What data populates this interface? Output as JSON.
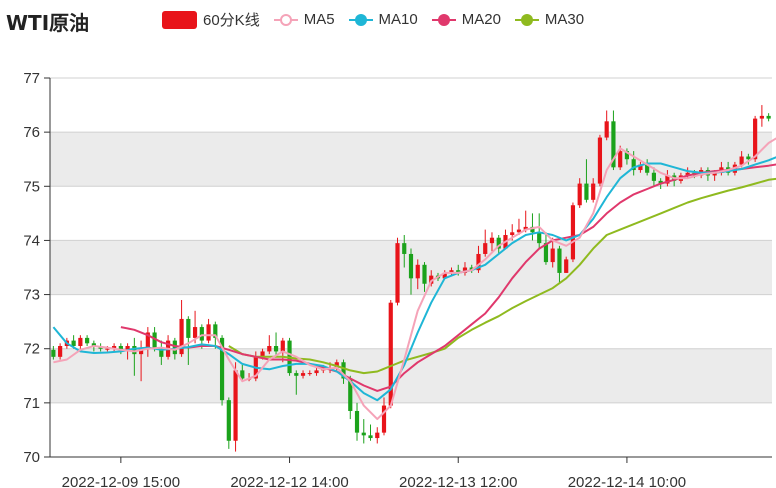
{
  "header": {
    "title": "WTI原油"
  },
  "legend": [
    {
      "label": "60分K线",
      "kind": "bar",
      "color": "#e8141a"
    },
    {
      "label": "MA5",
      "kind": "line",
      "color": "#f5a3b8"
    },
    {
      "label": "MA10",
      "kind": "line",
      "color": "#1fb6d6"
    },
    {
      "label": "MA20",
      "kind": "line",
      "color": "#e0386c"
    },
    {
      "label": "MA30",
      "kind": "line",
      "color": "#8fba1f"
    }
  ],
  "colors": {
    "up": "#e8141a",
    "down": "#1ba21b",
    "band": "#ebebeb",
    "grid": "#d0d0d0",
    "axis": "#333333"
  },
  "chart_data": {
    "type": "candlestick",
    "ylim": [
      70,
      77
    ],
    "yticks": [
      70,
      71,
      72,
      73,
      74,
      75,
      76,
      77
    ],
    "xtick_labels": [
      "2022-12-09 15:00",
      "2022-12-12 14:00",
      "2022-12-13 12:00",
      "2022-12-14 10:00"
    ],
    "xtick_index": [
      10,
      35,
      60,
      85
    ],
    "candles": [
      [
        71.98,
        71.85,
        72.05,
        71.8
      ],
      [
        71.85,
        72.05,
        72.1,
        71.8
      ],
      [
        72.05,
        72.15,
        72.2,
        72.0
      ],
      [
        72.15,
        72.05,
        72.25,
        72.0
      ],
      [
        72.05,
        72.2,
        72.25,
        72.0
      ],
      [
        72.2,
        72.1,
        72.25,
        72.05
      ],
      [
        72.1,
        72.05,
        72.15,
        71.95
      ],
      [
        72.05,
        72.0,
        72.1,
        71.95
      ],
      [
        72.0,
        72.0,
        72.05,
        71.95
      ],
      [
        72.0,
        72.05,
        72.1,
        71.95
      ],
      [
        72.05,
        71.95,
        72.1,
        71.9
      ],
      [
        71.95,
        72.05,
        72.1,
        71.8
      ],
      [
        72.05,
        71.9,
        72.2,
        71.5
      ],
      [
        71.9,
        72.0,
        72.15,
        71.4
      ],
      [
        72.0,
        72.3,
        72.4,
        71.85
      ],
      [
        72.3,
        72.0,
        72.4,
        71.95
      ],
      [
        72.0,
        71.85,
        72.15,
        71.7
      ],
      [
        71.85,
        72.15,
        72.25,
        71.8
      ],
      [
        72.15,
        71.9,
        72.2,
        71.8
      ],
      [
        71.9,
        72.55,
        72.9,
        71.85
      ],
      [
        72.55,
        72.2,
        72.6,
        71.7
      ],
      [
        72.2,
        72.4,
        72.7,
        72.1
      ],
      [
        72.4,
        72.15,
        72.45,
        72.0
      ],
      [
        72.15,
        72.45,
        72.55,
        72.1
      ],
      [
        72.45,
        72.2,
        72.5,
        72.0
      ],
      [
        72.2,
        71.05,
        72.25,
        70.95
      ],
      [
        71.05,
        70.3,
        71.1,
        70.15
      ],
      [
        70.3,
        71.6,
        71.75,
        70.1
      ],
      [
        71.6,
        71.45,
        71.7,
        71.4
      ],
      [
        71.45,
        71.45,
        71.55,
        71.4
      ],
      [
        71.45,
        71.85,
        71.95,
        71.4
      ],
      [
        71.85,
        71.95,
        72.0,
        71.8
      ],
      [
        71.95,
        72.05,
        72.25,
        71.9
      ],
      [
        72.05,
        71.95,
        72.3,
        71.85
      ],
      [
        71.95,
        72.15,
        72.2,
        71.75
      ],
      [
        72.15,
        71.55,
        72.2,
        71.5
      ],
      [
        71.55,
        71.5,
        71.6,
        71.15
      ],
      [
        71.5,
        71.55,
        71.6,
        71.45
      ],
      [
        71.55,
        71.55,
        71.6,
        71.5
      ],
      [
        71.55,
        71.6,
        71.7,
        71.5
      ],
      [
        71.6,
        71.65,
        71.7,
        71.55
      ],
      [
        71.65,
        71.65,
        71.75,
        71.55
      ],
      [
        71.65,
        71.75,
        71.8,
        71.6
      ],
      [
        71.75,
        71.45,
        71.8,
        71.35
      ],
      [
        71.45,
        70.85,
        71.5,
        70.7
      ],
      [
        70.85,
        70.45,
        71.0,
        70.3
      ],
      [
        70.45,
        70.4,
        70.7,
        70.25
      ],
      [
        70.4,
        70.35,
        70.6,
        70.3
      ],
      [
        70.35,
        70.45,
        70.55,
        70.25
      ],
      [
        70.45,
        70.95,
        71.1,
        70.4
      ],
      [
        70.95,
        72.85,
        72.9,
        70.9
      ],
      [
        72.85,
        73.95,
        74.05,
        72.8
      ],
      [
        73.95,
        73.75,
        74.1,
        73.5
      ],
      [
        73.75,
        73.3,
        73.85,
        73.0
      ],
      [
        73.3,
        73.55,
        73.65,
        73.1
      ],
      [
        73.55,
        73.2,
        73.6,
        73.05
      ],
      [
        73.2,
        73.35,
        73.45,
        73.15
      ],
      [
        73.35,
        73.3,
        73.4,
        73.25
      ],
      [
        73.3,
        73.4,
        73.45,
        73.3
      ],
      [
        73.4,
        73.45,
        73.5,
        73.35
      ],
      [
        73.45,
        73.4,
        73.55,
        73.35
      ],
      [
        73.4,
        73.5,
        73.6,
        73.35
      ],
      [
        73.5,
        73.45,
        73.55,
        73.4
      ],
      [
        73.45,
        73.75,
        73.9,
        73.4
      ],
      [
        73.75,
        73.95,
        74.2,
        73.7
      ],
      [
        73.95,
        74.05,
        74.15,
        73.8
      ],
      [
        74.05,
        73.85,
        74.1,
        73.75
      ],
      [
        73.85,
        74.1,
        74.2,
        73.85
      ],
      [
        74.1,
        74.15,
        74.3,
        74.0
      ],
      [
        74.15,
        74.2,
        74.4,
        74.1
      ],
      [
        74.2,
        74.25,
        74.55,
        74.15
      ],
      [
        74.25,
        74.15,
        74.5,
        74.0
      ],
      [
        74.15,
        73.95,
        74.5,
        73.85
      ],
      [
        73.95,
        73.6,
        74.15,
        73.55
      ],
      [
        73.6,
        73.85,
        74.05,
        73.5
      ],
      [
        73.85,
        73.4,
        73.9,
        73.2
      ],
      [
        73.4,
        73.65,
        73.7,
        73.4
      ],
      [
        73.65,
        74.65,
        74.7,
        73.6
      ],
      [
        74.65,
        75.05,
        75.15,
        74.6
      ],
      [
        75.05,
        74.75,
        75.5,
        74.7
      ],
      [
        74.75,
        75.05,
        75.15,
        74.7
      ],
      [
        75.05,
        75.9,
        75.95,
        75.0
      ],
      [
        75.9,
        76.2,
        76.4,
        75.85
      ],
      [
        76.2,
        75.35,
        76.4,
        75.3
      ],
      [
        75.35,
        75.65,
        75.75,
        75.3
      ],
      [
        75.65,
        75.5,
        75.7,
        75.4
      ],
      [
        75.5,
        75.3,
        75.65,
        75.2
      ],
      [
        75.3,
        75.4,
        75.45,
        75.25
      ],
      [
        75.4,
        75.25,
        75.5,
        75.2
      ],
      [
        75.25,
        75.1,
        75.35,
        75.0
      ],
      [
        75.1,
        75.05,
        75.15,
        74.95
      ],
      [
        75.05,
        75.2,
        75.3,
        75.0
      ],
      [
        75.2,
        75.1,
        75.25,
        75.0
      ],
      [
        75.1,
        75.2,
        75.25,
        75.05
      ],
      [
        75.2,
        75.25,
        75.35,
        75.15
      ],
      [
        75.25,
        75.2,
        75.3,
        75.15
      ],
      [
        75.2,
        75.3,
        75.35,
        75.15
      ],
      [
        75.3,
        75.2,
        75.35,
        75.1
      ],
      [
        75.2,
        75.25,
        75.3,
        75.1
      ],
      [
        75.25,
        75.35,
        75.45,
        75.2
      ],
      [
        75.35,
        75.25,
        75.45,
        75.2
      ],
      [
        75.25,
        75.4,
        75.45,
        75.2
      ],
      [
        75.4,
        75.55,
        75.65,
        75.35
      ],
      [
        75.55,
        75.5,
        75.6,
        75.4
      ],
      [
        75.5,
        76.25,
        76.3,
        75.45
      ],
      [
        76.25,
        76.3,
        76.5,
        76.1
      ],
      [
        76.3,
        76.25,
        76.35,
        76.2
      ]
    ],
    "ma": {
      "MA5": [
        [
          0,
          71.75
        ],
        [
          2,
          71.8
        ],
        [
          4,
          71.98
        ],
        [
          6,
          72.05
        ],
        [
          8,
          72.02
        ],
        [
          10,
          71.98
        ],
        [
          12,
          71.95
        ],
        [
          14,
          72.0
        ],
        [
          16,
          72.02
        ],
        [
          18,
          71.98
        ],
        [
          20,
          72.1
        ],
        [
          22,
          72.25
        ],
        [
          24,
          72.25
        ],
        [
          26,
          71.8
        ],
        [
          28,
          71.4
        ],
        [
          30,
          71.5
        ],
        [
          32,
          71.8
        ],
        [
          34,
          71.95
        ],
        [
          36,
          71.85
        ],
        [
          38,
          71.7
        ],
        [
          40,
          71.62
        ],
        [
          42,
          71.65
        ],
        [
          44,
          71.4
        ],
        [
          46,
          70.95
        ],
        [
          48,
          70.7
        ],
        [
          50,
          70.95
        ],
        [
          52,
          71.8
        ],
        [
          54,
          72.7
        ],
        [
          56,
          73.25
        ],
        [
          58,
          73.4
        ],
        [
          60,
          73.4
        ],
        [
          62,
          73.45
        ],
        [
          64,
          73.65
        ],
        [
          66,
          73.9
        ],
        [
          68,
          74.05
        ],
        [
          70,
          74.2
        ],
        [
          72,
          74.25
        ],
        [
          74,
          74.0
        ],
        [
          76,
          73.9
        ],
        [
          78,
          74.05
        ],
        [
          80,
          74.5
        ],
        [
          82,
          75.3
        ],
        [
          84,
          75.7
        ],
        [
          86,
          75.55
        ],
        [
          88,
          75.4
        ],
        [
          90,
          75.25
        ],
        [
          92,
          75.15
        ],
        [
          94,
          75.15
        ],
        [
          96,
          75.22
        ],
        [
          98,
          75.25
        ],
        [
          100,
          75.3
        ],
        [
          102,
          75.38
        ],
        [
          104,
          75.55
        ],
        [
          106,
          75.8
        ],
        [
          108,
          75.95
        ]
      ],
      "MA10": [
        [
          0,
          72.4
        ],
        [
          2,
          72.1
        ],
        [
          4,
          71.95
        ],
        [
          6,
          71.92
        ],
        [
          8,
          71.93
        ],
        [
          10,
          71.95
        ],
        [
          12,
          72.0
        ],
        [
          14,
          72.02
        ],
        [
          16,
          71.98
        ],
        [
          18,
          72.0
        ],
        [
          20,
          72.03
        ],
        [
          22,
          72.08
        ],
        [
          24,
          72.05
        ],
        [
          26,
          71.9
        ],
        [
          28,
          71.72
        ],
        [
          30,
          71.65
        ],
        [
          32,
          71.62
        ],
        [
          34,
          71.68
        ],
        [
          36,
          71.72
        ],
        [
          38,
          71.72
        ],
        [
          40,
          71.68
        ],
        [
          42,
          71.58
        ],
        [
          44,
          71.4
        ],
        [
          46,
          71.18
        ],
        [
          48,
          71.05
        ],
        [
          50,
          71.25
        ],
        [
          52,
          71.7
        ],
        [
          54,
          72.3
        ],
        [
          56,
          72.85
        ],
        [
          58,
          73.3
        ],
        [
          60,
          73.4
        ],
        [
          62,
          73.45
        ],
        [
          64,
          73.55
        ],
        [
          66,
          73.75
        ],
        [
          68,
          73.95
        ],
        [
          70,
          74.1
        ],
        [
          72,
          74.15
        ],
        [
          74,
          74.1
        ],
        [
          76,
          74.0
        ],
        [
          78,
          74.1
        ],
        [
          80,
          74.4
        ],
        [
          82,
          74.8
        ],
        [
          84,
          75.15
        ],
        [
          86,
          75.35
        ],
        [
          88,
          75.42
        ],
        [
          90,
          75.42
        ],
        [
          92,
          75.35
        ],
        [
          94,
          75.28
        ],
        [
          96,
          75.25
        ],
        [
          98,
          75.25
        ],
        [
          100,
          75.28
        ],
        [
          102,
          75.32
        ],
        [
          104,
          75.4
        ],
        [
          106,
          75.48
        ],
        [
          108,
          75.58
        ]
      ],
      "MA20": [
        [
          10,
          72.4
        ],
        [
          12,
          72.35
        ],
        [
          14,
          72.25
        ],
        [
          16,
          72.12
        ],
        [
          18,
          72.05
        ],
        [
          20,
          72.02
        ],
        [
          22,
          72.05
        ],
        [
          24,
          72.05
        ],
        [
          26,
          71.98
        ],
        [
          28,
          71.9
        ],
        [
          30,
          71.85
        ],
        [
          32,
          71.8
        ],
        [
          34,
          71.8
        ],
        [
          36,
          71.78
        ],
        [
          38,
          71.72
        ],
        [
          40,
          71.65
        ],
        [
          42,
          71.58
        ],
        [
          44,
          71.45
        ],
        [
          46,
          71.32
        ],
        [
          48,
          71.22
        ],
        [
          50,
          71.3
        ],
        [
          52,
          71.55
        ],
        [
          54,
          71.75
        ],
        [
          56,
          71.9
        ],
        [
          58,
          72.05
        ],
        [
          60,
          72.25
        ],
        [
          62,
          72.45
        ],
        [
          64,
          72.65
        ],
        [
          66,
          72.95
        ],
        [
          68,
          73.3
        ],
        [
          70,
          73.6
        ],
        [
          72,
          73.85
        ],
        [
          74,
          74.0
        ],
        [
          76,
          74.05
        ],
        [
          78,
          74.1
        ],
        [
          80,
          74.25
        ],
        [
          82,
          74.5
        ],
        [
          84,
          74.7
        ],
        [
          86,
          74.85
        ],
        [
          88,
          74.95
        ],
        [
          90,
          75.05
        ],
        [
          92,
          75.12
        ],
        [
          94,
          75.2
        ],
        [
          96,
          75.25
        ],
        [
          98,
          75.28
        ],
        [
          100,
          75.3
        ],
        [
          102,
          75.32
        ],
        [
          104,
          75.35
        ],
        [
          106,
          75.38
        ],
        [
          108,
          75.42
        ]
      ],
      "MA30": [
        [
          26,
          72.05
        ],
        [
          28,
          71.9
        ],
        [
          30,
          71.85
        ],
        [
          32,
          71.85
        ],
        [
          34,
          71.85
        ],
        [
          36,
          71.82
        ],
        [
          38,
          71.8
        ],
        [
          40,
          71.75
        ],
        [
          42,
          71.68
        ],
        [
          44,
          71.6
        ],
        [
          46,
          71.55
        ],
        [
          48,
          71.58
        ],
        [
          50,
          71.68
        ],
        [
          52,
          71.78
        ],
        [
          54,
          71.85
        ],
        [
          56,
          71.92
        ],
        [
          58,
          72.0
        ],
        [
          60,
          72.2
        ],
        [
          62,
          72.35
        ],
        [
          64,
          72.48
        ],
        [
          66,
          72.6
        ],
        [
          68,
          72.75
        ],
        [
          70,
          72.88
        ],
        [
          72,
          73.0
        ],
        [
          74,
          73.12
        ],
        [
          76,
          73.3
        ],
        [
          78,
          73.55
        ],
        [
          80,
          73.85
        ],
        [
          82,
          74.1
        ],
        [
          84,
          74.2
        ],
        [
          86,
          74.3
        ],
        [
          88,
          74.4
        ],
        [
          90,
          74.5
        ],
        [
          92,
          74.6
        ],
        [
          94,
          74.7
        ],
        [
          96,
          74.78
        ],
        [
          98,
          74.85
        ],
        [
          100,
          74.92
        ],
        [
          102,
          74.98
        ],
        [
          104,
          75.05
        ],
        [
          106,
          75.12
        ],
        [
          108,
          75.15
        ]
      ]
    }
  }
}
